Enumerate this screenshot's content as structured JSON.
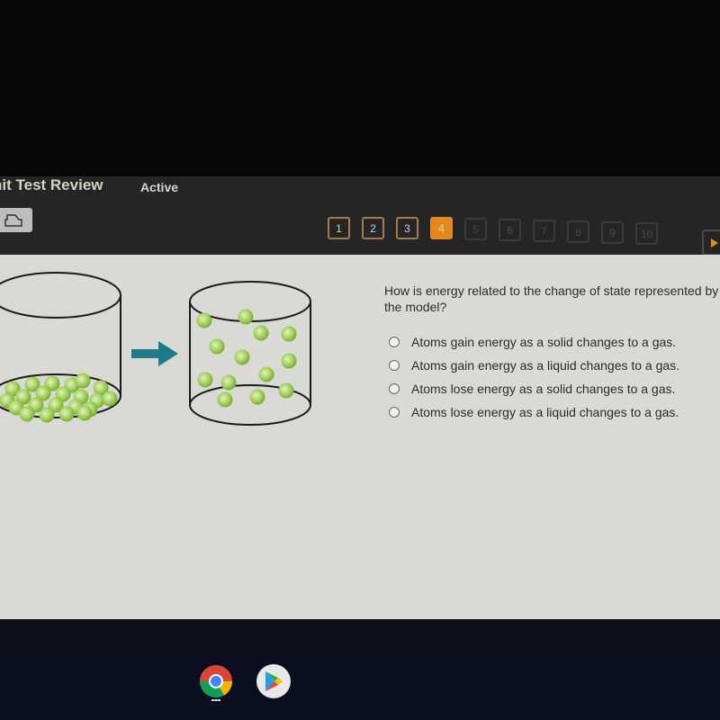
{
  "header": {
    "title": "nit Test Review",
    "status": "Active"
  },
  "toolbar": {
    "print_icon": "printer-icon"
  },
  "pager": {
    "pages": [
      {
        "label": "1",
        "state": "answered"
      },
      {
        "label": "2",
        "state": "answered"
      },
      {
        "label": "3",
        "state": "answered"
      },
      {
        "label": "4",
        "state": "current"
      },
      {
        "label": "5",
        "state": "disabled"
      },
      {
        "label": "6",
        "state": "disabled"
      },
      {
        "label": "7",
        "state": "disabled"
      },
      {
        "label": "8",
        "state": "disabled"
      },
      {
        "label": "9",
        "state": "disabled"
      },
      {
        "label": "10",
        "state": "disabled"
      }
    ],
    "next_icon": "play-triangle-icon"
  },
  "question": {
    "text": "How is energy related to the change of state represented by the model?",
    "options": [
      "Atoms gain energy as a solid changes to a gas.",
      "Atoms gain energy as a liquid changes to a gas.",
      "Atoms lose energy as a solid changes to a gas.",
      "Atoms lose energy as a liquid changes to a gas."
    ]
  },
  "figure": {
    "description": "Container with packed particles at bottom, arrow, container with spread-out particles",
    "arrow_color": "#1f7a8c",
    "particle_color": "#8cc34a"
  },
  "shelf": {
    "apps": [
      {
        "name": "Chrome",
        "running": true
      },
      {
        "name": "Play Store",
        "running": false
      }
    ]
  },
  "colors": {
    "accent": "#e38a1f",
    "answered_border": "#a67a4a"
  }
}
